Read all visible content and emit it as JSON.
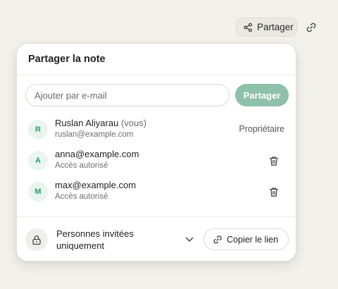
{
  "toolbar": {
    "share_label": "Partager",
    "share_icon": "share-icon",
    "link_icon": "link-icon"
  },
  "popover": {
    "title": "Partager la note",
    "invite": {
      "placeholder": "Ajouter par e-mail",
      "button_label": "Partager"
    },
    "members": [
      {
        "initial": "R",
        "name": "Ruslan Aliyarau",
        "you_suffix": "(vous)",
        "email": "ruslan@example.com",
        "role": "Propriétaire"
      },
      {
        "initial": "A",
        "name": "anna@example.com",
        "status": "Accès autorisé"
      },
      {
        "initial": "M",
        "name": "max@example.com",
        "status": "Accès autorisé"
      }
    ],
    "access": {
      "label": "Personnes invitées uniquement",
      "lock_icon": "lock-icon",
      "copy_label": "Copier le lien"
    }
  },
  "colors": {
    "background": "#f3f1ec",
    "accent": "#8fc0a9",
    "avatar_bg": "#e9f5ef",
    "avatar_text": "#2f9a68"
  }
}
